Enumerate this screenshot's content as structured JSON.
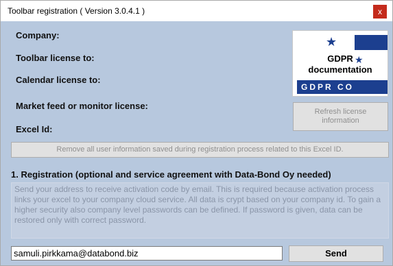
{
  "window": {
    "title": "Toolbar registration  ( Version 3.0.4.1 )",
    "close_glyph": "x"
  },
  "labels": {
    "company": "Company:",
    "toolbar_license": "Toolbar license to:",
    "calendar_license": "Calendar license to:",
    "market_feed": "Market feed or monitor license:",
    "excel_id": "Excel Id:"
  },
  "gdpr": {
    "line1": "GDPR",
    "line2": "documentation",
    "banner": "GDPR CO"
  },
  "buttons": {
    "refresh": "Refresh license information",
    "remove": "Remove all user information saved during registration process related to this Excel ID.",
    "send": "Send"
  },
  "registration": {
    "heading": "1. Registration (optional and service agreement with Data-Bond Oy needed)",
    "info": "Send your address to receive activation code by email. This is required because activation process links your excel to your company cloud service. All data is crypt based on your company id. To gain a higher security also company level passwords can be defined. If password is given, data can be restored only with correct password.",
    "email_value": "samuli.pirkkama@databond.biz"
  },
  "colors": {
    "background": "#b7c8de",
    "gdpr_blue": "#1c3f8f",
    "close_red": "#c42b1c"
  }
}
